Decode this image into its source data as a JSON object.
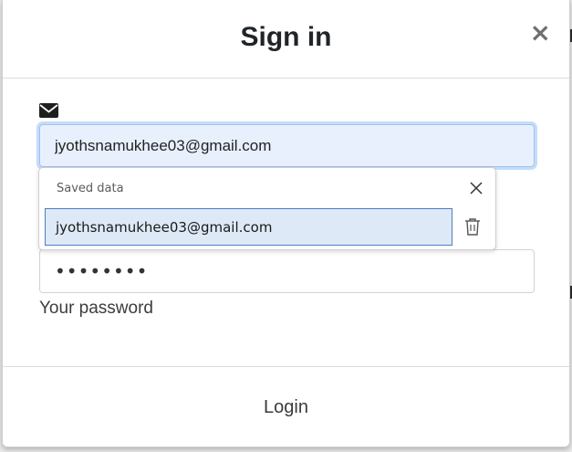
{
  "dialog": {
    "title": "Sign in",
    "close_glyph": "×"
  },
  "form": {
    "email_icon": "envelope-icon",
    "email_value": "jyothsnamukhee03@gmail.com",
    "password_value": "••••••••",
    "password_label": "Your password"
  },
  "autofill": {
    "title": "Saved data",
    "entry": "jyothsnamukhee03@gmail.com",
    "close_icon": "close-icon",
    "delete_icon": "trash-icon"
  },
  "footer": {
    "login_label": "Login"
  },
  "colors": {
    "email_bg": "#e8f0fe",
    "focus_ring": "#c6dcf9",
    "selected_entry_bg": "#dde9f7",
    "selected_entry_border": "#4f7dbd"
  }
}
